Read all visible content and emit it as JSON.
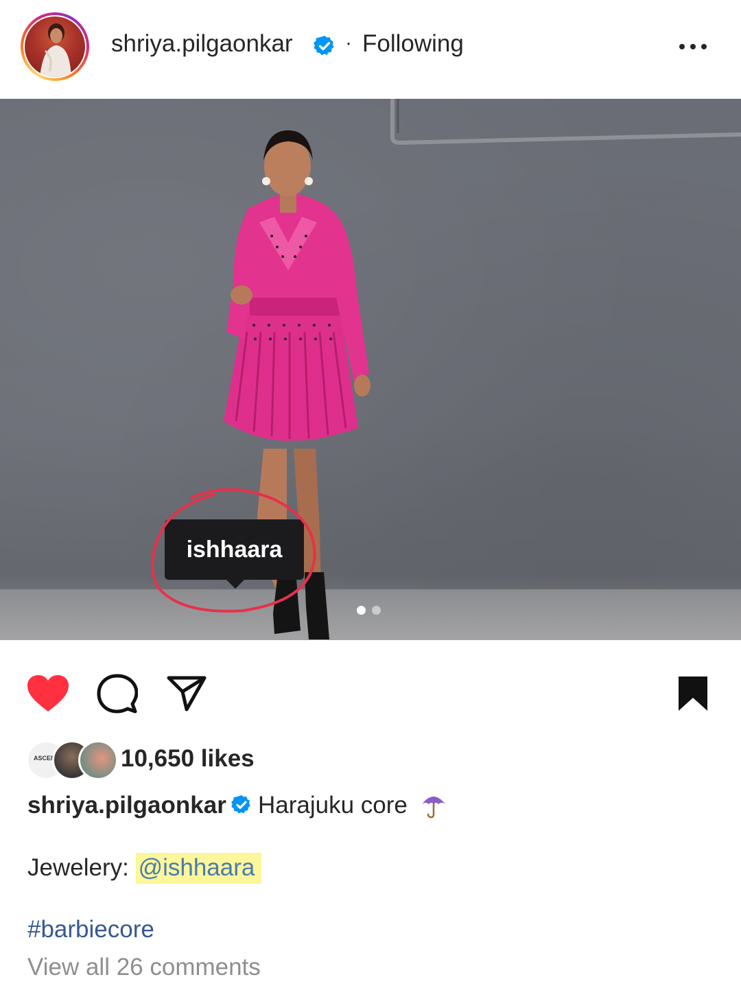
{
  "header": {
    "username": "shriya.pilgaonkar",
    "separator": "·",
    "follow_status": "Following"
  },
  "photo": {
    "tag_label": "ishhaara",
    "carousel_count": 2,
    "carousel_active": 1
  },
  "actions": {
    "liked": true,
    "saved": true
  },
  "likes": {
    "count_text": "10,650 likes",
    "liker_avatar_text": "ASCEN"
  },
  "caption": {
    "username": "shriya.pilgaonkar",
    "text": "Harajuku core",
    "emoji_icon": "umbrella-emoji"
  },
  "jewelry": {
    "label": "Jewelery:",
    "mention": "@ishhaara"
  },
  "hashtag": "#barbiecore",
  "comments_link": "View all 26 comments",
  "colors": {
    "like_red": "#ff3040",
    "verified_blue": "#0095f6",
    "hashtag_blue": "#35598f",
    "mention_highlight": "#fbf79a",
    "dress_pink": "#e0338f"
  }
}
